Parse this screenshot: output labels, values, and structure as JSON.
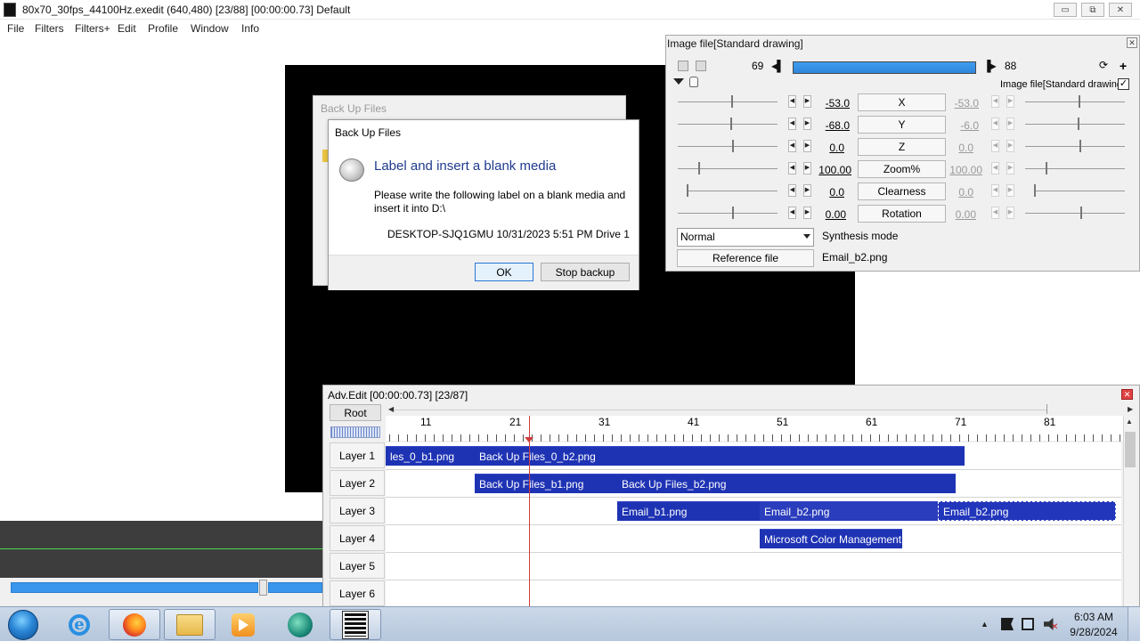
{
  "window": {
    "title": "80x70_30fps_44100Hz.exedit (640,480)  [23/88]  [00:00:00.73]  Default",
    "minimize": "▭",
    "maximize": "⧉",
    "close": "✕"
  },
  "menu": [
    "File",
    "Filters",
    "Filters+",
    "Edit",
    "Profile",
    "Window",
    "Info"
  ],
  "background_dialog": {
    "title": "Back Up Files"
  },
  "dialog": {
    "title": "Back Up Files",
    "heading": "Label and insert a blank media",
    "message": "Please write the following label on a blank media and insert it into D:\\",
    "label": "DESKTOP-SJQ1GMU 10/31/2023 5:51 PM Drive 1",
    "ok": "OK",
    "stop": "Stop backup"
  },
  "panel": {
    "title": "Image file[Standard drawing]",
    "frame_start": "69",
    "frame_end": "88",
    "object_label": "Image file[Standard drawing]",
    "object_checked": "✓",
    "params": [
      {
        "name": "X",
        "value": "-53.0",
        "value2": "-53.0"
      },
      {
        "name": "Y",
        "value": "-68.0",
        "value2": "-6.0"
      },
      {
        "name": "Z",
        "value": "0.0",
        "value2": "0.0"
      },
      {
        "name": "Zoom%",
        "value": "100.00",
        "value2": "100.00"
      },
      {
        "name": "Clearness",
        "value": "0.0",
        "value2": "0.0"
      },
      {
        "name": "Rotation",
        "value": "0.00",
        "value2": "0.00"
      }
    ],
    "blend_mode": "Normal",
    "synthesis_label": "Synthesis mode",
    "reference_button": "Reference file",
    "reference_file": "Email_b2.png"
  },
  "timeline": {
    "title": "Adv.Edit [00:00:00.73] [23/87]",
    "root": "Root",
    "ruler": [
      "11",
      "21",
      "31",
      "41",
      "51",
      "61",
      "71",
      "81"
    ],
    "layers": [
      "Layer 1",
      "Layer 2",
      "Layer 3",
      "Layer 4",
      "Layer 5",
      "Layer 6"
    ],
    "clips": [
      {
        "layer": 1,
        "label": "les_0_b1.png"
      },
      {
        "layer": 1,
        "label": "Back Up Files_0_b2.png"
      },
      {
        "layer": 2,
        "label": "Back Up Files_b1.png"
      },
      {
        "layer": 2,
        "label": "Back Up Files_b2.png"
      },
      {
        "layer": 3,
        "label": "Email_b1.png"
      },
      {
        "layer": 3,
        "label": "Email_b2.png"
      },
      {
        "layer": 3,
        "label": "Email_b2.png"
      },
      {
        "layer": 4,
        "label": "Microsoft Color Management"
      }
    ]
  },
  "taskbar": {
    "time": "6:03 AM",
    "date": "9/28/2024",
    "apps": [
      "internet-explorer",
      "firefox",
      "file-explorer",
      "media-player",
      "teal-app",
      "film-app"
    ]
  },
  "colors": {
    "clip": "#1e33b4",
    "playhead": "#d23c3c",
    "frame_bar": "#3a96ec"
  }
}
